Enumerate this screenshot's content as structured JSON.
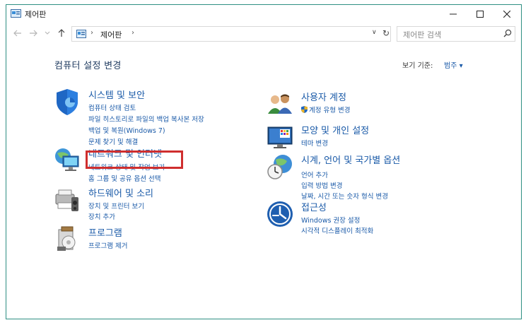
{
  "window": {
    "title": "제어판"
  },
  "navigation": {
    "breadcrumb_root": "제어판",
    "search_placeholder": "제어판 검색"
  },
  "main": {
    "heading": "컴퓨터 설정 변경",
    "view_by_label": "보기 기준:",
    "view_by_value": "범주 ▾"
  },
  "categories_left": [
    {
      "icon": "shield-icon",
      "title": "시스템 및 보안",
      "links": [
        "컴퓨터 상태 검토",
        "파일 히스토리로 파일의 백업 복사본 저장",
        "백업 및 복원(Windows 7)",
        "문제 찾기 및 해결"
      ]
    },
    {
      "icon": "network-icon",
      "title": "네트워크 및 인터넷",
      "links": [
        "네트워크 상태 및 작업 보기",
        "홈 그룹 및 공유 옵션 선택"
      ]
    },
    {
      "icon": "hardware-icon",
      "title": "하드웨어 및 소리",
      "links": [
        "장치 및 프린터 보기",
        "장치 추가"
      ]
    },
    {
      "icon": "programs-icon",
      "title": "프로그램",
      "links": [
        "프로그램 제거"
      ]
    }
  ],
  "categories_right": [
    {
      "icon": "users-icon",
      "title": "사용자 계정",
      "links": [
        "계정 유형 변경"
      ]
    },
    {
      "icon": "appearance-icon",
      "title": "모양 및 개인 설정",
      "links": [
        "테마 변경"
      ]
    },
    {
      "icon": "clock-globe-icon",
      "title": "시계, 언어 및 국가별 옵션",
      "links": [
        "언어 추가",
        "입력 방법 변경",
        "날짜, 시간 또는 숫자 형식 변경"
      ]
    },
    {
      "icon": "ease-of-access-icon",
      "title": "접근성",
      "links": [
        "Windows 권장 설정",
        "시각적 디스플레이 최적화"
      ]
    }
  ],
  "colors": {
    "link": "#1a5aa8",
    "heading": "#1e3a5f",
    "window_border": "#2f8f83",
    "highlight": "#cf2e2e"
  }
}
